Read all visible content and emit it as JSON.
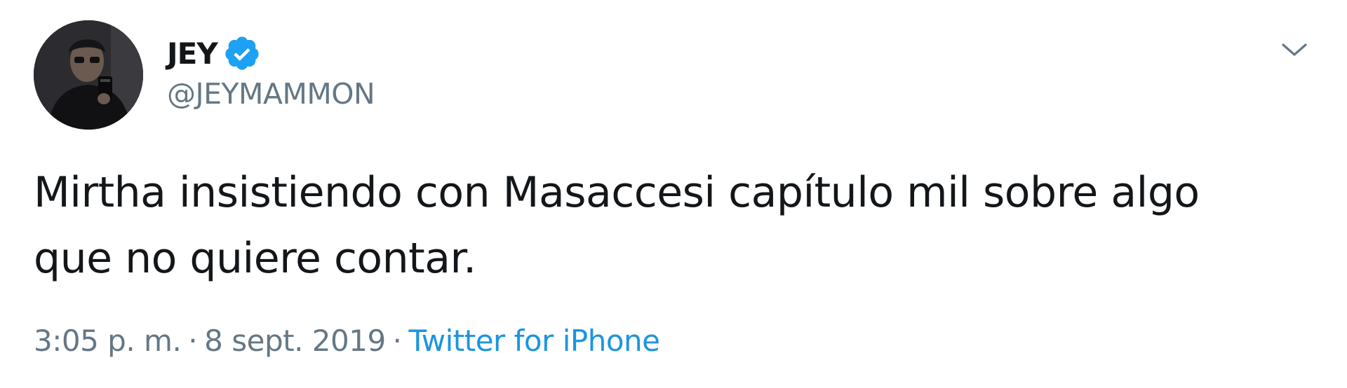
{
  "tweet": {
    "display_name": "JEY",
    "handle": "@JEYMAMMON",
    "verified": true,
    "text": "Mirtha insistiendo con Masaccesi capítulo mil sobre algo que no quiere contar.",
    "time": "3:05 p. m.",
    "separator": "·",
    "date": "8 sept. 2019",
    "source": "Twitter for iPhone"
  },
  "icons": {
    "avatar": "profile-photo",
    "verified": "verified-badge-icon",
    "caret": "chevron-down-icon"
  },
  "colors": {
    "text": "#14171a",
    "secondary": "#657786",
    "link": "#1b95e0",
    "verified": "#1da1f2"
  }
}
